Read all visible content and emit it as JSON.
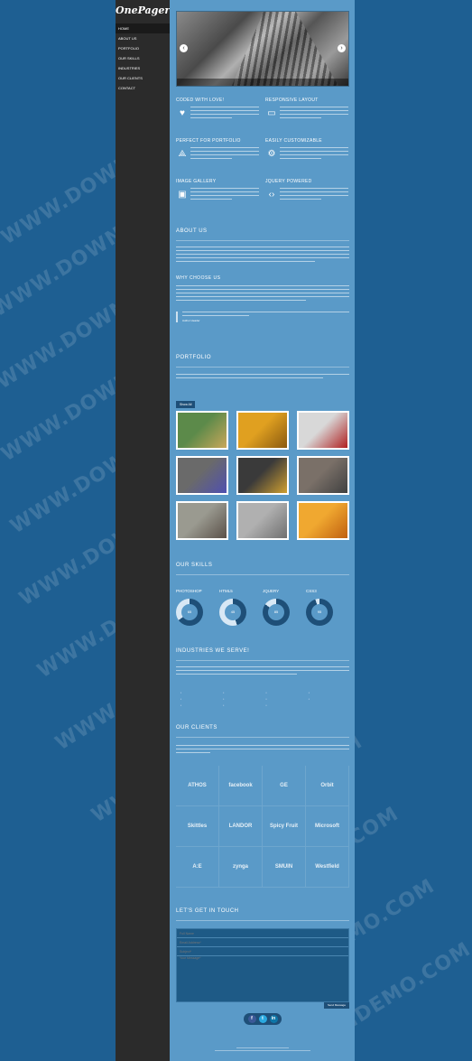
{
  "sidebar": {
    "logo": "OnePager",
    "nav": [
      "HOME",
      "ABOUT US",
      "PORTFOLIO",
      "OUR SKILLS",
      "INDUSTRIES",
      "OUR CLIENTS",
      "CONTACT"
    ]
  },
  "slider": {
    "prev_icon": "chevron-left-icon",
    "next_icon": "chevron-right-icon"
  },
  "features": [
    {
      "title": "CODED WITH LOVE!",
      "icon": "heart-icon"
    },
    {
      "title": "RESPONSIVE LAYOUT",
      "icon": "monitor-icon"
    },
    {
      "title": "PERFECT FOR PORTFOLIO",
      "icon": "compass-icon"
    },
    {
      "title": "EASILY CUSTOMIZABLE",
      "icon": "gear-icon"
    },
    {
      "title": "IMAGE GALLERY",
      "icon": "image-icon"
    },
    {
      "title": "JQUERY POWERED",
      "icon": "code-icon"
    }
  ],
  "about": {
    "title": "ABOUT US",
    "subtitle": "WHY CHOOSE US",
    "quote_author": "Author Header"
  },
  "portfolio": {
    "title": "PORTFOLIO",
    "filters": [
      "Show All"
    ],
    "items": [
      {
        "colors": [
          "#5c8a4a",
          "#c9a75a"
        ]
      },
      {
        "colors": [
          "#e0a020",
          "#8a5a10"
        ]
      },
      {
        "colors": [
          "#d8d8d8",
          "#b02020"
        ]
      },
      {
        "colors": [
          "#6a6a6a",
          "#5050b0"
        ]
      },
      {
        "colors": [
          "#3a3a3a",
          "#d0a030"
        ]
      },
      {
        "colors": [
          "#7a7068",
          "#404040"
        ]
      },
      {
        "colors": [
          "#9a9a90",
          "#5a5048"
        ]
      },
      {
        "colors": [
          "#b0b0b0",
          "#707070"
        ]
      },
      {
        "colors": [
          "#f0a830",
          "#c06010"
        ]
      }
    ]
  },
  "skills": {
    "title": "OUR SKILLS",
    "items": [
      {
        "label": "PHOTOSHOP",
        "value": 65
      },
      {
        "label": "HTML5",
        "value": 45
      },
      {
        "label": "JQUERY",
        "value": 85
      },
      {
        "label": "CSS3",
        "value": 95
      }
    ]
  },
  "industries": {
    "title": "INDUSTRIES WE SERVE!"
  },
  "clients": {
    "title": "OUR CLIENTS",
    "logos": [
      "ATHOS",
      "facebook",
      "GE",
      "Orbit",
      "Skittles",
      "LANDOR",
      "Spicy Fruit",
      "Microsoft",
      "A:E",
      "zynga",
      "SMUIN",
      "Westfield"
    ]
  },
  "contact": {
    "title": "LET'S GET IN TOUCH",
    "placeholders": {
      "name": "Full Name",
      "email": "Email Address*",
      "subject": "Subject*",
      "message": "Your Message*"
    },
    "send": "Send Message"
  },
  "social": [
    {
      "icon": "facebook-icon",
      "glyph": "f",
      "color": "#3b5998"
    },
    {
      "icon": "twitter-icon",
      "glyph": "t",
      "color": "#2aa9e0"
    },
    {
      "icon": "linkedin-icon",
      "glyph": "in",
      "color": "#0e76a8"
    }
  ],
  "colors": {
    "page_bg": "#1e5f92",
    "sidebar_bg": "#2b2b2b",
    "content_bg": "#5a9ac8",
    "donut_fill": "#1e4f78",
    "donut_track": "#d8e8f5"
  }
}
